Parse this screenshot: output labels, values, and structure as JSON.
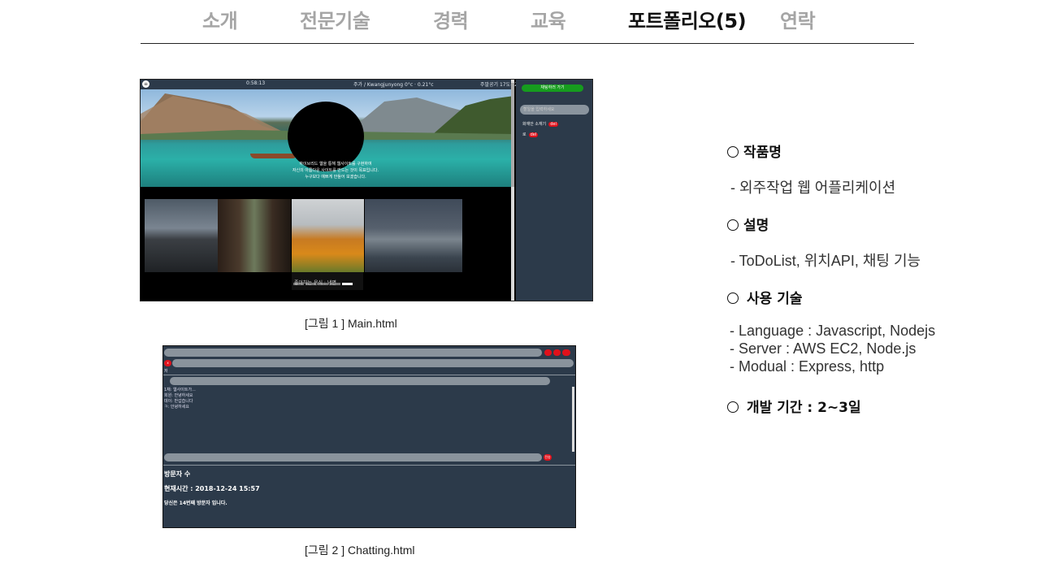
{
  "nav": {
    "items": [
      {
        "label": "소개"
      },
      {
        "label": "전문기술"
      },
      {
        "label": "경력"
      },
      {
        "label": "교육"
      },
      {
        "label": "포트폴리오(5)"
      },
      {
        "label": "연락"
      }
    ],
    "active_index": 4
  },
  "figure1": {
    "caption": "[그림 1 ] Main.html",
    "topbar": {
      "left": "0:58:13",
      "center": "주가 / Kwangjunyong 0°c · 0.21°c",
      "right": "주말공기 17도~22도"
    },
    "hero_lines": [
      "하이브리드 웹을 통해 웹사이트를 구현하여",
      "자신의 아름다운 사이트를 만드는 것이 목표입니다.",
      "누구보다 예쁘게 만들어 보겠습니다."
    ],
    "caption_box": "좋아하는 음식 : 냉면",
    "side": {
      "button": "채팅하러 가기",
      "input_placeholder": "할일을 입력하세요",
      "items": [
        {
          "text": "화재안 소재기",
          "badge": "del"
        },
        {
          "text": "로",
          "badge": "del"
        }
      ]
    }
  },
  "figure2": {
    "caption": "[그림 2 ] Chatting.html",
    "mini_labels": [
      "x",
      "저"
    ],
    "chat_lines": [
      "1채: 웹사이트가...",
      "회원: 안녕하세요",
      "데이: 반갑습니다",
      "ㅋ: 안녕하세요"
    ],
    "send_label": "전송",
    "visitor_title": "방문자 수",
    "current_time": "현재시간 : 2018-12-24 15:57",
    "visitor_text": "당신은 14번째 방문자 입니다."
  },
  "info": {
    "sections": [
      {
        "title": "작품명",
        "lines": [
          "- 외주작업 웹 어플리케이션"
        ]
      },
      {
        "title": "설명",
        "lines": [
          "- ToDoList, 위치API, 채팅 기능"
        ]
      },
      {
        "title": "사용 기술",
        "lines": [
          "- Language : Javascript, Nodejs",
          "- Server : AWS EC2, Node.js",
          "- Modual : Express, http"
        ]
      },
      {
        "title": "개발 기간  : 2~3일",
        "lines": []
      }
    ]
  },
  "colors": {
    "app_bg": "#2c3a4a",
    "accent_red": "#e0111b",
    "accent_green": "#169c1e",
    "nav_inactive": "#a5a5a5"
  }
}
